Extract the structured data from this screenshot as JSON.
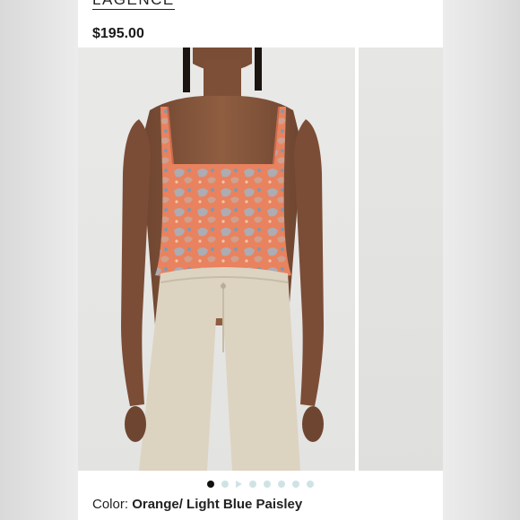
{
  "product": {
    "brand": "LAGENCE",
    "price": "$195.00",
    "color_label": "Color:",
    "color_value": "Orange/ Light Blue Paisley"
  },
  "gallery": {
    "total_dots": 8,
    "active_index": 0,
    "video_index": 2
  },
  "colors": {
    "top_orange": "#e8825f",
    "paisley_blue": "#9fb6c8",
    "jeans": "#ddd3c1",
    "skin": "#8a5a3d",
    "dot_inactive": "#cfe3e6",
    "dot_active": "#111111"
  }
}
